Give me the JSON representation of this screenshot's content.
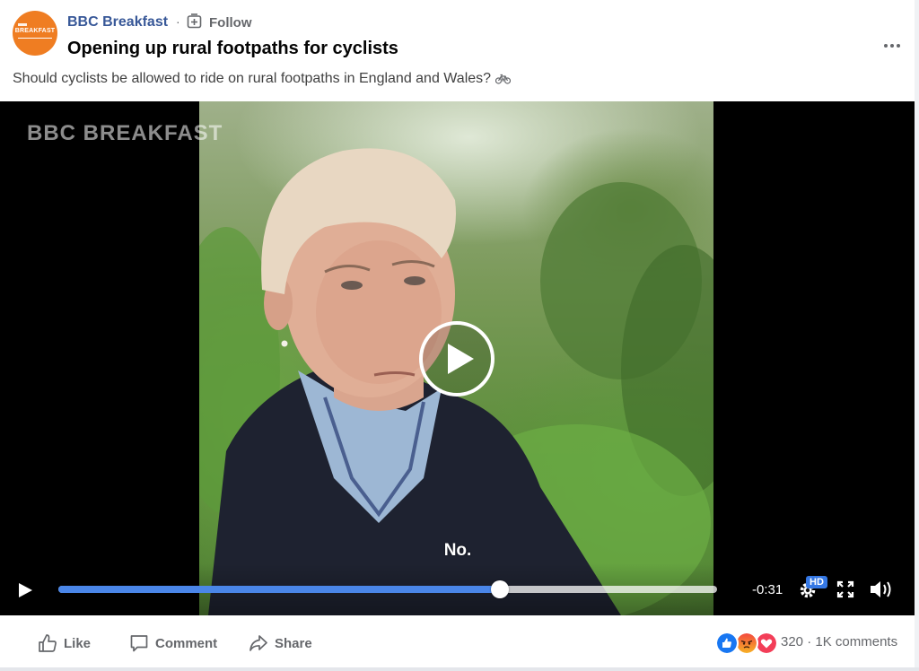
{
  "post": {
    "page_name": "BBC Breakfast",
    "separator": "·",
    "follow_label": "Follow",
    "title": "Opening up rural footpaths for cyclists",
    "description": "Should cyclists be allowed to ride on rural footpaths in England and Wales?",
    "description_icon": "bicycle-icon",
    "avatar_text": "BREAKFAST"
  },
  "video": {
    "watermark": "BBC BREAKFAST",
    "caption": "No.",
    "progress": 0.67,
    "time_remaining": "-0:31",
    "quality_badge": "HD",
    "accent_color": "#4a86e8"
  },
  "actions": {
    "like_label": "Like",
    "comment_label": "Comment",
    "share_label": "Share"
  },
  "engagement": {
    "reaction_count": "320",
    "separator": "·",
    "comments": "1K comments",
    "reactions": [
      "like",
      "angry",
      "love"
    ]
  }
}
